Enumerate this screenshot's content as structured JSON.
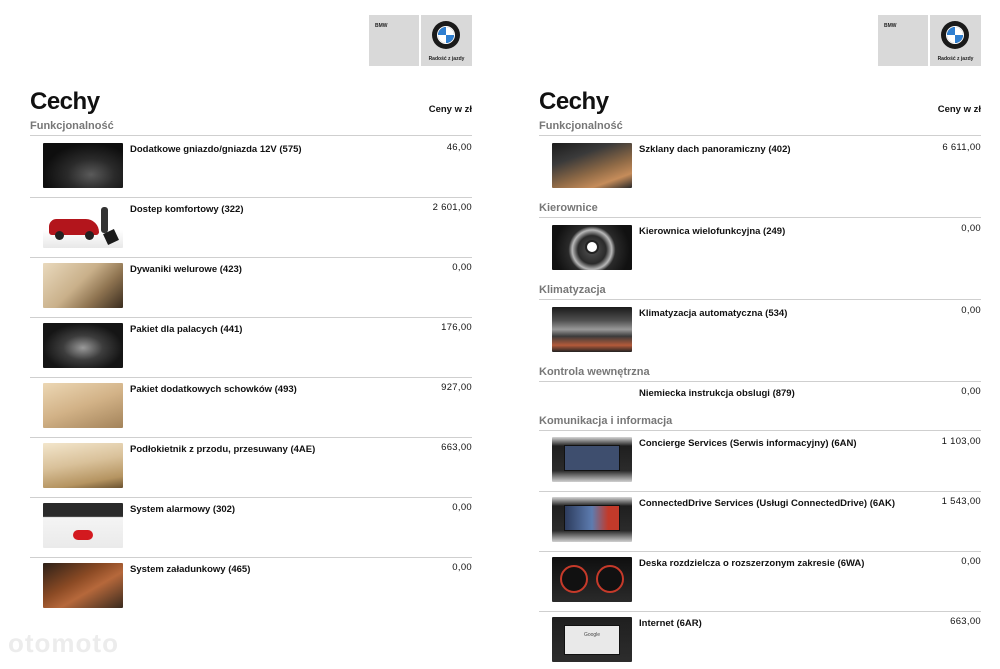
{
  "watermark": "otomoto",
  "pages": [
    {
      "logo": {
        "brand": "BMW",
        "slogan": "Radość z jazdy"
      },
      "title": "Cechy",
      "price_header": "Ceny w zł",
      "sections": [
        {
          "title": "Funkcjonalność",
          "items": [
            {
              "name": "Dodatkowe gniazdo/gniazda 12V (575)",
              "price": "46,00",
              "icon": "socket-image"
            },
            {
              "name": "Dostep komfortowy (322)",
              "price": "2 601,00",
              "icon": "car-trunk-image"
            },
            {
              "name": "Dywaniki welurowe (423)",
              "price": "0,00",
              "icon": "floor-mats-image"
            },
            {
              "name": "Pakiet dla palacych (441)",
              "price": "176,00",
              "icon": "ashtray-image"
            },
            {
              "name": "Pakiet dodatkowych schowków (493)",
              "price": "927,00",
              "icon": "storage-image"
            },
            {
              "name": "Podłokietnik z przodu, przesuwany (4AE)",
              "price": "663,00",
              "icon": "armrest-image"
            },
            {
              "name": "System alarmowy (302)",
              "price": "0,00",
              "icon": "alarm-image"
            },
            {
              "name": "System załadunkowy (465)",
              "price": "0,00",
              "icon": "loading-system-image"
            }
          ]
        }
      ]
    },
    {
      "logo": {
        "brand": "BMW",
        "slogan": "Radość z jazdy"
      },
      "title": "Cechy",
      "price_header": "Ceny w zł",
      "sections": [
        {
          "title": "Funkcjonalność",
          "items": [
            {
              "name": "Szklany dach panoramiczny (402)",
              "price": "6 611,00",
              "icon": "panoramic-roof-image"
            }
          ]
        },
        {
          "title": "Kierownice",
          "items": [
            {
              "name": "Kierownica wielofunkcyjna (249)",
              "price": "0,00",
              "icon": "steering-wheel-image"
            }
          ]
        },
        {
          "title": "Klimatyzacja",
          "items": [
            {
              "name": "Klimatyzacja automatyczna (534)",
              "price": "0,00",
              "icon": "climate-control-image"
            }
          ]
        },
        {
          "title": "Kontrola wewnętrzna",
          "items": [
            {
              "name": "Niemiecka instrukcja obslugi (879)",
              "price": "0,00",
              "icon": "none"
            }
          ]
        },
        {
          "title": "Komunikacja i informacja",
          "items": [
            {
              "name": "Concierge Services (Serwis informacyjny) (6AN)",
              "price": "1 103,00",
              "icon": "concierge-screen-image"
            },
            {
              "name": "ConnectedDrive Services (Usługi ConnectedDrive) (6AK)",
              "price": "1 543,00",
              "icon": "connecteddrive-screen-image"
            },
            {
              "name": "Deska rozdzielcza o rozszerzonym zakresie (6WA)",
              "price": "0,00",
              "icon": "instrument-cluster-image"
            },
            {
              "name": "Internet (6AR)",
              "price": "663,00",
              "icon": "internet-screen-image",
              "screen_text": "Google"
            }
          ]
        }
      ]
    }
  ]
}
